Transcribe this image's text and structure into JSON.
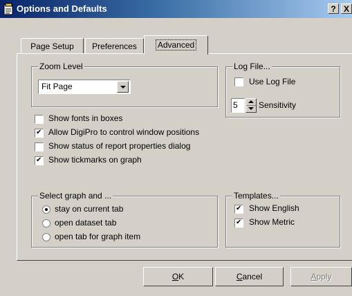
{
  "window": {
    "title": "Options and Defaults",
    "help_label": "?",
    "close_label": "X"
  },
  "tabs": [
    {
      "label": "Page Setup"
    },
    {
      "label": "Preferences"
    },
    {
      "label": "Advanced",
      "active": true
    }
  ],
  "zoom": {
    "legend": "Zoom Level",
    "value": "Fit Page"
  },
  "logfile": {
    "legend": "Log File...",
    "use_label": "Use Log File",
    "use_checked": false,
    "sensitivity_value": "5",
    "sensitivity_label": "Sensitivity"
  },
  "options": [
    {
      "label": "Show fonts in boxes",
      "checked": false
    },
    {
      "label": "Allow DigiPro to control window positions",
      "checked": true
    },
    {
      "label": "Show status of report properties dialog",
      "checked": false
    },
    {
      "label": "Show tickmarks on graph",
      "checked": true
    }
  ],
  "select_graph": {
    "legend": "Select graph and ...",
    "radios": [
      {
        "label": "stay on current tab",
        "checked": true
      },
      {
        "label": "open dataset tab",
        "checked": false
      },
      {
        "label": "open tab for graph item",
        "checked": false
      }
    ]
  },
  "templates": {
    "legend": "Templates...",
    "items": [
      {
        "label": "Show English",
        "checked": true
      },
      {
        "label": "Show Metric",
        "checked": true
      }
    ]
  },
  "buttons": {
    "ok_mnemonic": "O",
    "ok_rest": "K",
    "cancel_mnemonic": "C",
    "cancel_rest": "ancel",
    "apply_mnemonic": "A",
    "apply_rest": "pply"
  },
  "colors": {
    "titlebar_start": "#0a246a",
    "titlebar_end": "#a6caf0",
    "face": "#d4d0c8"
  }
}
